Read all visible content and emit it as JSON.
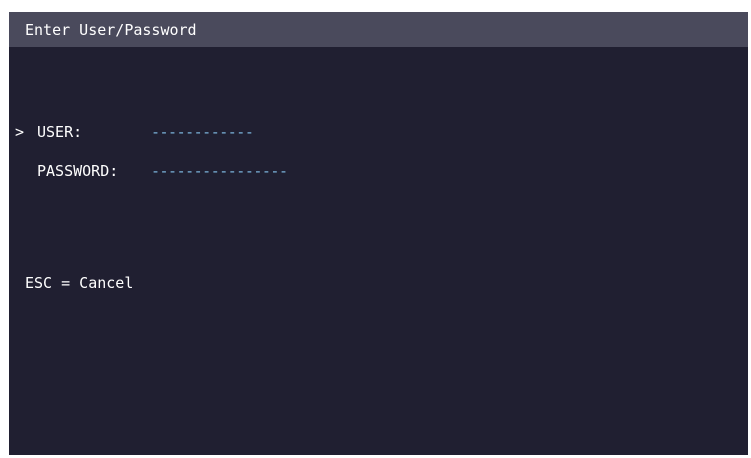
{
  "window": {
    "title": "Enter User/Password"
  },
  "form": {
    "cursor": ">",
    "fields": [
      {
        "label": "USER:",
        "value": "------------"
      },
      {
        "label": "PASSWORD:",
        "value": "----------------"
      }
    ]
  },
  "footer": {
    "hint": "ESC = Cancel"
  },
  "colors": {
    "background": "#201f31",
    "titlebar": "#4a4a5c",
    "text": "#ffffff",
    "field_value": "#7db6df"
  }
}
